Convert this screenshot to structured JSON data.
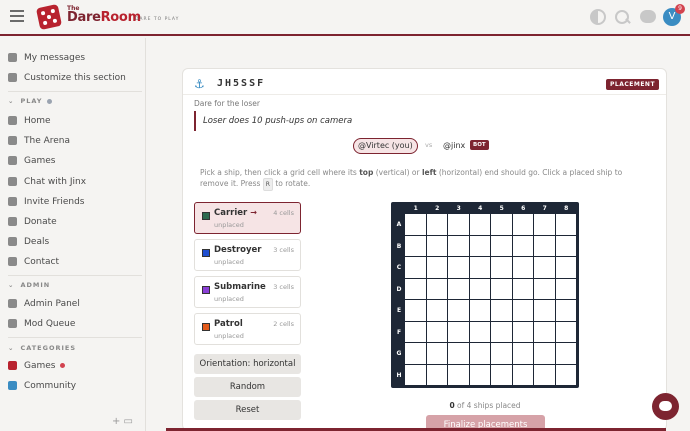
{
  "header": {
    "logo_the": "The",
    "logo_dare": "Dare",
    "logo_room": "Room",
    "tagline": "DARE TO PLAY",
    "avatar_letter": "V",
    "notif_count": "9"
  },
  "sidebar": {
    "top_items": [
      {
        "label": "My messages",
        "icon": "mail-icon"
      },
      {
        "label": "Customize this section",
        "icon": "pencil-icon"
      }
    ],
    "play_header": "PLAY",
    "play_items": [
      {
        "label": "Home",
        "icon": "home-icon"
      },
      {
        "label": "The Arena",
        "icon": "bolt-icon"
      },
      {
        "label": "Games",
        "icon": "dice-icon"
      },
      {
        "label": "Chat with Jinx",
        "icon": "chat-icon"
      },
      {
        "label": "Invite Friends",
        "icon": "user-plus-icon"
      },
      {
        "label": "Donate",
        "icon": "heart-icon"
      },
      {
        "label": "Deals",
        "icon": "tag-icon"
      },
      {
        "label": "Contact",
        "icon": "envelope-icon"
      }
    ],
    "admin_header": "ADMIN",
    "admin_items": [
      {
        "label": "Admin Panel",
        "icon": "shield-icon"
      },
      {
        "label": "Mod Queue",
        "icon": "flag-icon"
      }
    ],
    "categories_header": "CATEGORIES",
    "category_items": [
      {
        "label": "Games",
        "icon": "dice-icon"
      },
      {
        "label": "Community",
        "icon": "chat-icon"
      }
    ],
    "colors": {
      "play_dot": "#9aa3b0",
      "games_dot": "#d2434f"
    }
  },
  "game": {
    "code": "JH5SSF",
    "phase": "PLACEMENT",
    "dare_label": "Dare for the loser",
    "dare_text": "Loser does 10 push-ups on camera",
    "player1": "@Virtec (you)",
    "vs": "vs",
    "player2": "@jinx",
    "bot_badge": "BOT",
    "instructions": {
      "part1": "Pick a ship, then click a grid cell where its ",
      "top": "top",
      "part2": " (vertical) or ",
      "left": "left",
      "part3": " (horizontal) end should go. Click a placed ship to remove it. Press ",
      "key": "R",
      "part4": " to rotate."
    },
    "ships": [
      {
        "name": "Carrier",
        "cells": "4 cells",
        "status": "unplaced",
        "color": "#2d6a4f",
        "selected": true
      },
      {
        "name": "Destroyer",
        "cells": "3 cells",
        "status": "unplaced",
        "color": "#1f4fd1",
        "selected": false
      },
      {
        "name": "Submarine",
        "cells": "3 cells",
        "status": "unplaced",
        "color": "#8a3fd6",
        "selected": false
      },
      {
        "name": "Patrol",
        "cells": "2 cells",
        "status": "unplaced",
        "color": "#e35b1c",
        "selected": false
      }
    ],
    "orientation_button": "Orientation: horizontal",
    "random_button": "Random",
    "reset_button": "Reset",
    "board": {
      "columns": [
        "1",
        "2",
        "3",
        "4",
        "5",
        "6",
        "7",
        "8"
      ],
      "rows": [
        "A",
        "B",
        "C",
        "D",
        "E",
        "F",
        "G",
        "H"
      ]
    },
    "placed_count": "0",
    "placed_text": " of 4 ships placed",
    "finalize_button": "Finalize placements"
  }
}
